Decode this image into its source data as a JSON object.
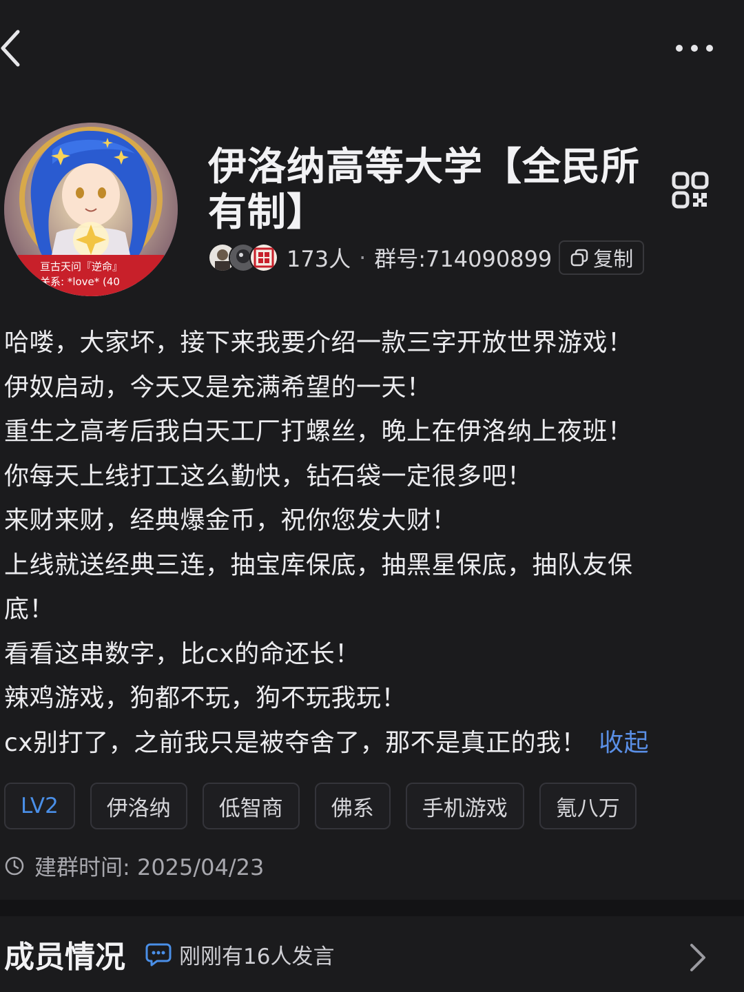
{
  "group": {
    "name": "伊洛纳高等大学【全民所有制】",
    "member_count": "173人",
    "separator": "·",
    "group_id_label": "群号:714090899",
    "copy_label": "复制",
    "avatar_caption_1": "亘古天问『逆命』",
    "avatar_caption_2": "关系: *love* (40"
  },
  "description": {
    "lines": [
      "哈喽，大家坏，接下来我要介绍一款三字开放世界游戏！",
      "伊奴启动，今天又是充满希望的一天！",
      "重生之高考后我白天工厂打螺丝，晚上在伊洛纳上夜班！",
      "你每天上线打工这么勤快，钻石袋一定很多吧！",
      "来财来财，经典爆金币，祝你您发大财！",
      "上线就送经典三连，抽宝库保底，抽黑星保底，抽队友保底！",
      "看看这串数字，比cx的命还长！",
      "辣鸡游戏，狗都不玩，狗不玩我玩！",
      "cx别打了，之前我只是被夺舍了，那不是真正的我！"
    ],
    "collapse_label": "收起"
  },
  "tags": [
    "LV2",
    "伊洛纳",
    "低智商",
    "佛系",
    "手机游戏",
    "氪八万"
  ],
  "created": {
    "label": "建群时间: 2025/04/23"
  },
  "members_section": {
    "title": "成员情况",
    "status": "刚刚有16人发言"
  },
  "colors": {
    "background": "#1b1b1d",
    "accent_link": "#5a8fe6",
    "level_tag": "#4a8fe8"
  },
  "icons": [
    "back-arrow-icon",
    "more-dots-icon",
    "qr-code-icon",
    "copy-icon",
    "clock-icon",
    "chat-bubble-icon",
    "chevron-right-icon"
  ]
}
